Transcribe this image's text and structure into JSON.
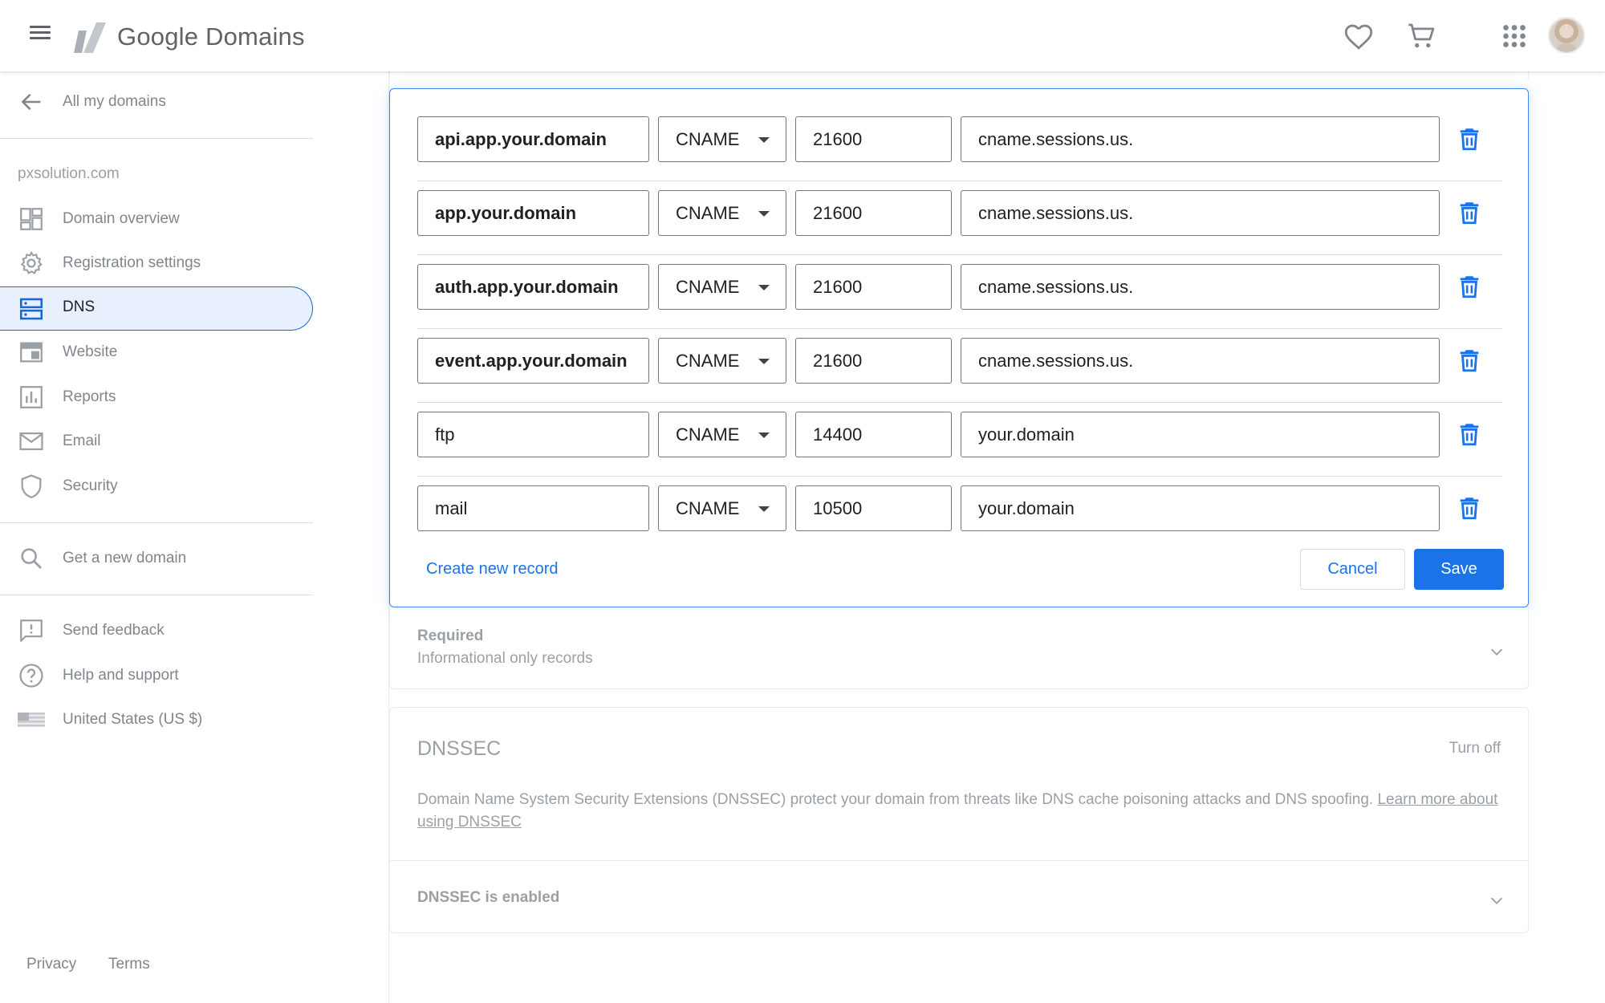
{
  "app": {
    "title": "Google Domains",
    "menu_icon": "hamburger-menu-icon",
    "logo_icon": "google-domains-logo-icon",
    "header_icons": [
      "heart-icon",
      "cart-icon",
      "apps-grid-icon"
    ]
  },
  "sidebar": {
    "back_label": "All my domains",
    "domain": "pxsolution.com",
    "items": [
      {
        "label": "Domain overview",
        "icon": "dashboard-icon"
      },
      {
        "label": "Registration settings",
        "icon": "gear-icon"
      },
      {
        "label": "DNS",
        "icon": "dns-icon",
        "active": true
      },
      {
        "label": "Website",
        "icon": "website-icon"
      },
      {
        "label": "Reports",
        "icon": "bar-chart-icon"
      },
      {
        "label": "Email",
        "icon": "mail-icon"
      },
      {
        "label": "Security",
        "icon": "shield-icon"
      }
    ],
    "get_new_domain": "Get a new domain",
    "send_feedback": "Send feedback",
    "help_support": "Help and support",
    "region": "United States (US $)",
    "footer": {
      "privacy": "Privacy",
      "terms": "Terms"
    }
  },
  "records": [
    {
      "name": "api.app.your.domain",
      "type": "CNAME",
      "ttl": "21600",
      "data": "cname.sessions.us."
    },
    {
      "name": "app.your.domain",
      "type": "CNAME",
      "ttl": "21600",
      "data": "cname.sessions.us."
    },
    {
      "name": "auth.app.your.domain",
      "type": "CNAME",
      "ttl": "21600",
      "data": "cname.sessions.us."
    },
    {
      "name": "event.app.your.domain",
      "type": "CNAME",
      "ttl": "21600",
      "data": "cname.sessions.us."
    },
    {
      "name": "ftp",
      "type": "CNAME",
      "ttl": "14400",
      "data": "your.domain"
    },
    {
      "name": "mail",
      "type": "CNAME",
      "ttl": "10500",
      "data": "your.domain"
    }
  ],
  "editor": {
    "create_new_record": "Create new record",
    "cancel": "Cancel",
    "save": "Save"
  },
  "required": {
    "title": "Required",
    "subtitle": "Informational only records"
  },
  "dnssec": {
    "title": "DNSSEC",
    "turn_off": "Turn off",
    "description": "Domain Name System Security Extensions (DNSSEC) protect your domain from threats like DNS cache poisoning attacks and DNS spoofing.",
    "learn_more": "Learn more about using DNSSEC",
    "status": "DNSSEC is enabled"
  },
  "colors": {
    "accent": "#1a73e8",
    "active_nav_bg": "#e8f0fe",
    "muted_text": "#80868b"
  }
}
